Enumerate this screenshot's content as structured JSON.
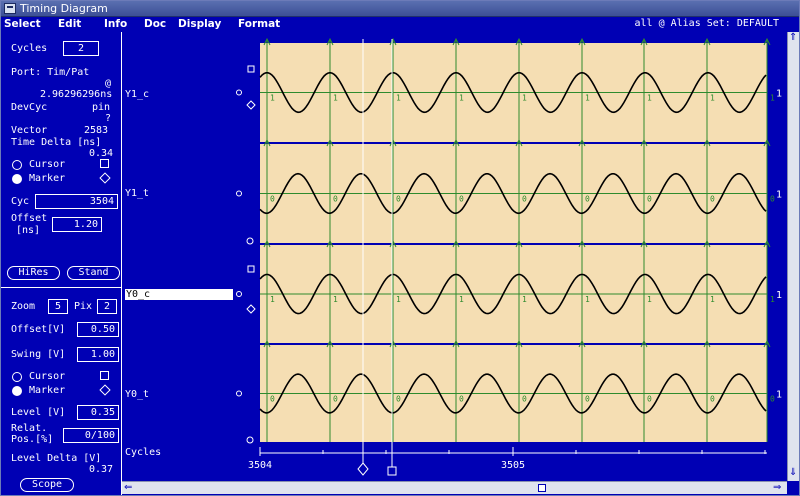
{
  "window": {
    "title": "Timing Diagram"
  },
  "menu": {
    "items": [
      "Select",
      "Edit",
      "Info",
      "Doc",
      "Display",
      "Format"
    ],
    "right_text": "all   @ Alias Set: DEFAULT"
  },
  "panel": {
    "cycles_label": "Cycles",
    "cycles_value": "2",
    "port_label": "Port: Tim/Pat",
    "at_label": "@",
    "period_value": "2.96296296ns",
    "devcyc_label": "DevCyc",
    "pin_label": "pin",
    "devcyc_value": "?",
    "vector_label": "Vector",
    "vector_value": "2583",
    "time_delta_label": "Time Delta [ns]",
    "time_delta_value": "0.34",
    "cursor_label": "Cursor",
    "marker_label": "Marker",
    "cyc_label": "Cyc",
    "cyc_value": "3504",
    "offset_label_1": "Offset",
    "offset_label_2": "[ns]",
    "offset_value": "1.20",
    "hires_label": "HiRes",
    "stand_label": "Stand",
    "zoom_label": "Zoom",
    "zoom_value": "5",
    "pix_label": "Pix",
    "pix_value": "2",
    "offsetv_label": "Offset[V]",
    "offsetv_value": "0.50",
    "swing_label": "Swing [V]",
    "swing_value": "1.00",
    "cursor2_label": "Cursor",
    "marker2_label": "Marker",
    "level_label": "Level [V]",
    "level_value": "0.35",
    "relat_label_1": "Relat.",
    "relat_label_2": "Pos.[%]",
    "relat_value": "0/100",
    "level_delta_label": "Level Delta [V]",
    "level_delta_value": "0.37",
    "scope_label": "Scope"
  },
  "signals": [
    {
      "name": "Y1_c",
      "mark": "1",
      "right_label": "1",
      "selected": false
    },
    {
      "name": "Y1_t",
      "mark": "0",
      "right_label": "1",
      "selected": false
    },
    {
      "name": "Y0_c",
      "mark": "1",
      "right_label": "1",
      "selected": true
    },
    {
      "name": "Y0_t",
      "mark": "0",
      "right_label": "1",
      "selected": false
    }
  ],
  "axis": {
    "label": "Cycles",
    "ticks": [
      "3504",
      "3505"
    ]
  },
  "colors": {
    "background": "#0000b4",
    "lane": "#f5deb3",
    "waveform": "#000000",
    "edge_lines": "#2e8b2e",
    "threshold": "#2e8b2e",
    "cursor_lines": "#ffffff"
  },
  "icons": {
    "cursor": "square-icon",
    "marker": "diamond-icon",
    "scroll_up": "arrow-up-icon",
    "scroll_down": "arrow-down-icon",
    "scroll_left": "arrow-left-icon",
    "scroll_right": "arrow-right-icon"
  }
}
